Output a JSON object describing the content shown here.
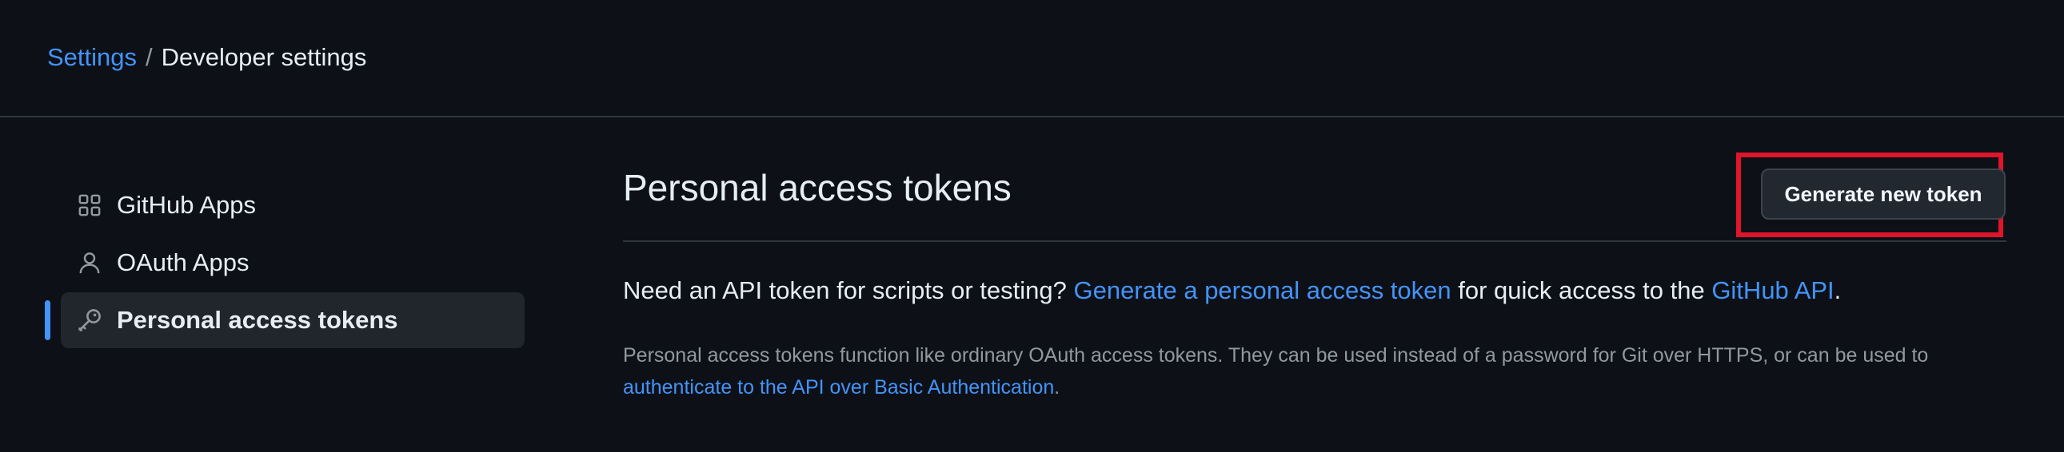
{
  "breadcrumb": {
    "parent": "Settings",
    "separator": "/",
    "current": "Developer settings"
  },
  "sidebar": {
    "items": [
      {
        "label": "GitHub Apps",
        "icon": "apps-grid-icon",
        "active": false
      },
      {
        "label": "OAuth Apps",
        "icon": "person-icon",
        "active": false
      },
      {
        "label": "Personal access tokens",
        "icon": "key-icon",
        "active": true
      }
    ]
  },
  "main": {
    "title": "Personal access tokens",
    "generate_button": "Generate new token",
    "lead": {
      "before": "Need an API token for scripts or testing? ",
      "link1": "Generate a personal access token",
      "middle": " for quick access to the ",
      "link2": "GitHub API",
      "after": "."
    },
    "note": {
      "text": "Personal access tokens function like ordinary OAuth access tokens. They can be used instead of a password for Git over HTTPS, or can be used to ",
      "link": "authenticate to the API over Basic Authentication",
      "after": "."
    }
  },
  "colors": {
    "background": "#0d1117",
    "link": "#4493f8",
    "highlight": "#e0142b",
    "active_marker": "#4493f8"
  }
}
